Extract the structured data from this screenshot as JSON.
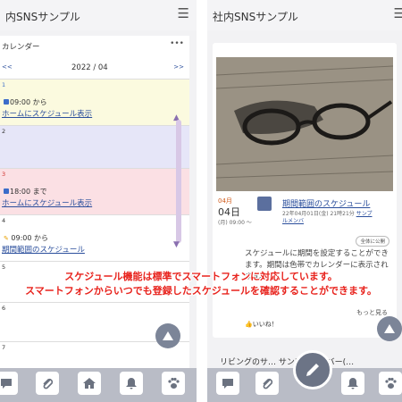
{
  "left": {
    "app_title": "内SNSサンプル",
    "calendar_title": "カレンダー",
    "calendar_more": "•••",
    "prev": "<<",
    "month": "2022 / 04",
    "next": ">>",
    "days": [
      {
        "num": "1",
        "time": "09:00 から",
        "link": "ホームにスケジュール表示"
      },
      {
        "num": "2",
        "time": "",
        "link": ""
      },
      {
        "num": "3",
        "time": "18:00 まで",
        "link": "ホームにスケジュール表示"
      },
      {
        "num": "4",
        "time": "09:00 から",
        "link": "期間範囲のスケジュール"
      },
      {
        "num": "5",
        "time": "",
        "link": ""
      },
      {
        "num": "6",
        "time": "",
        "link": ""
      },
      {
        "num": "7",
        "time": "",
        "link": ""
      }
    ]
  },
  "right": {
    "app_title": "社内SNSサンプル",
    "post": {
      "month": "04月",
      "day": "04日",
      "time": "(月) 09:00 〜",
      "title": "期間範囲のスケジュール",
      "meta": "22年04月01日(金) 21時21分",
      "author": "サンプ",
      "author2": "ルメンバ",
      "scope": "全体に公開",
      "body": "スケジュールに期間を設定することができます。期間は色帯でカレンダーに表示されます。",
      "more": "もっと見る",
      "like": "いいね！"
    },
    "next_post": "リビングのサ… サンプルメンバー(…"
  },
  "caption": {
    "line1": "スケジュール機能は標準でスマートフォンに対応しています。",
    "line2": "スマートフォンからいつでも登録したスケジュールを確認することができます。"
  },
  "colors": {
    "accent": "#2a4e9c",
    "caption": "#e8231d",
    "nav_bar": "#b9bcc6",
    "fab": "#7c8598"
  }
}
